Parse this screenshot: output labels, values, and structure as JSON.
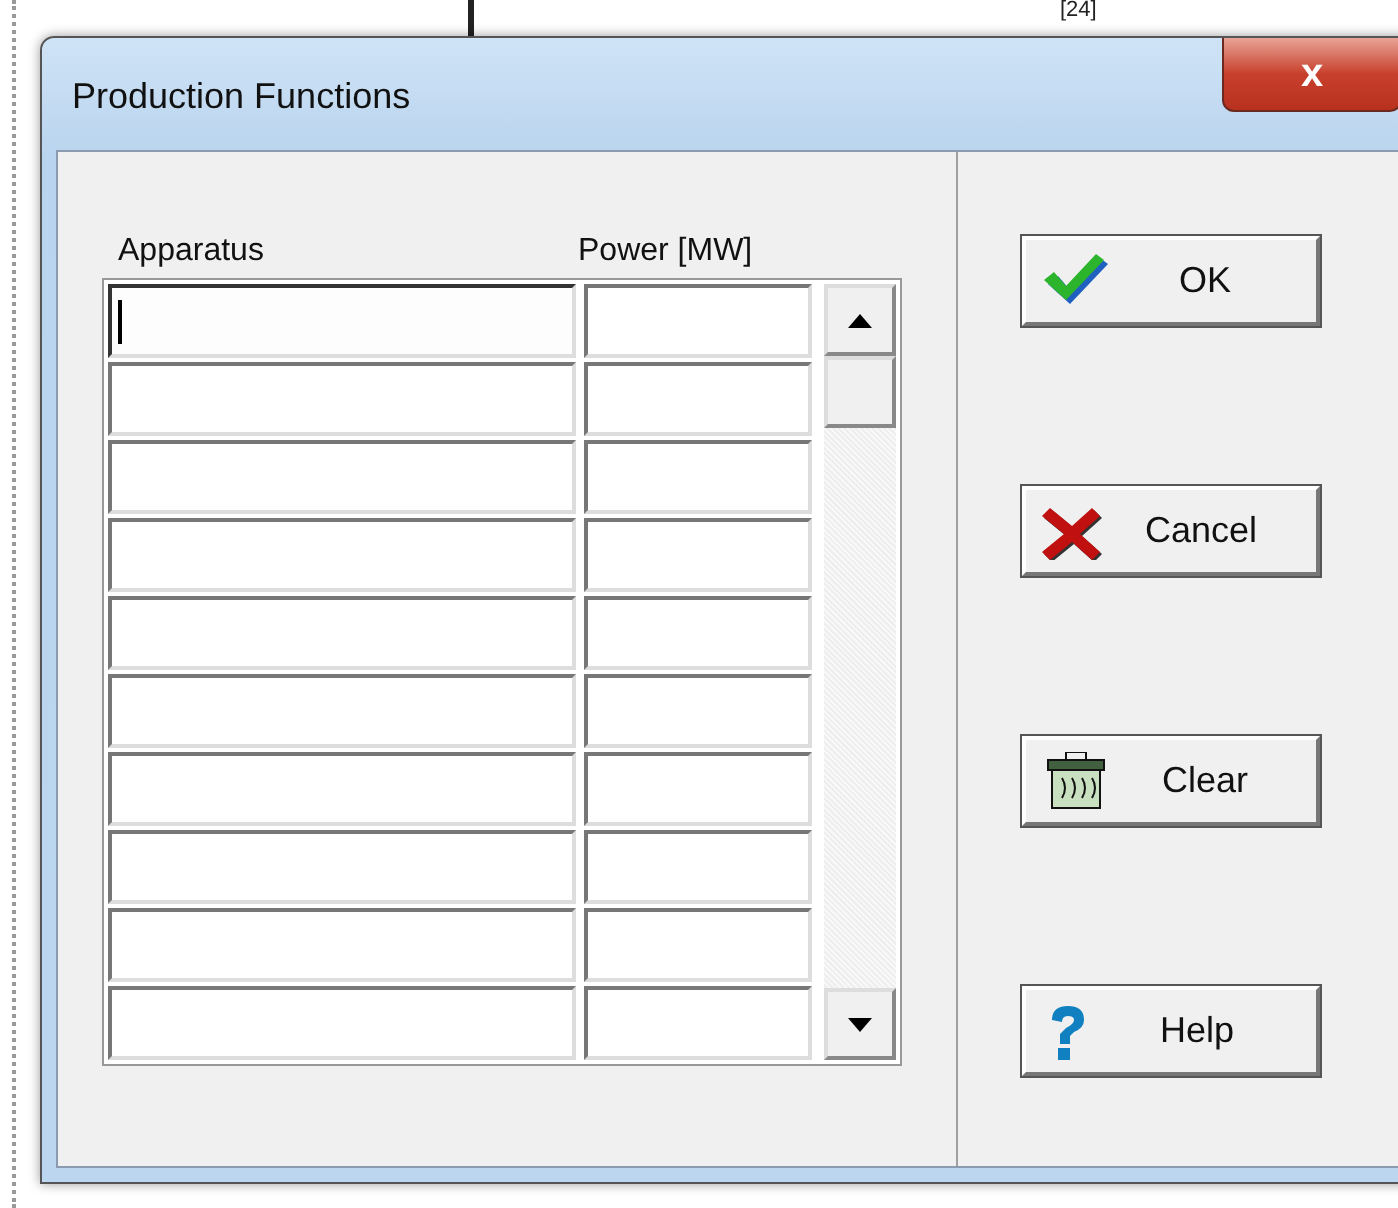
{
  "background": {
    "label": "[24]"
  },
  "window": {
    "title": "Production Functions",
    "close": "x"
  },
  "table": {
    "columns": [
      "Apparatus",
      "Power [MW]"
    ],
    "rows": [
      {
        "focused": true
      },
      {
        "focused": false
      },
      {
        "focused": false
      },
      {
        "focused": false
      },
      {
        "focused": false
      },
      {
        "focused": false
      },
      {
        "focused": false
      },
      {
        "focused": false
      },
      {
        "focused": false
      },
      {
        "focused": false
      }
    ]
  },
  "buttons": [
    {
      "kind": "ok",
      "label": "OK"
    },
    {
      "kind": "cancel",
      "label": "Cancel"
    },
    {
      "kind": "clear",
      "label": "Clear"
    },
    {
      "kind": "help",
      "label": "Help"
    }
  ]
}
